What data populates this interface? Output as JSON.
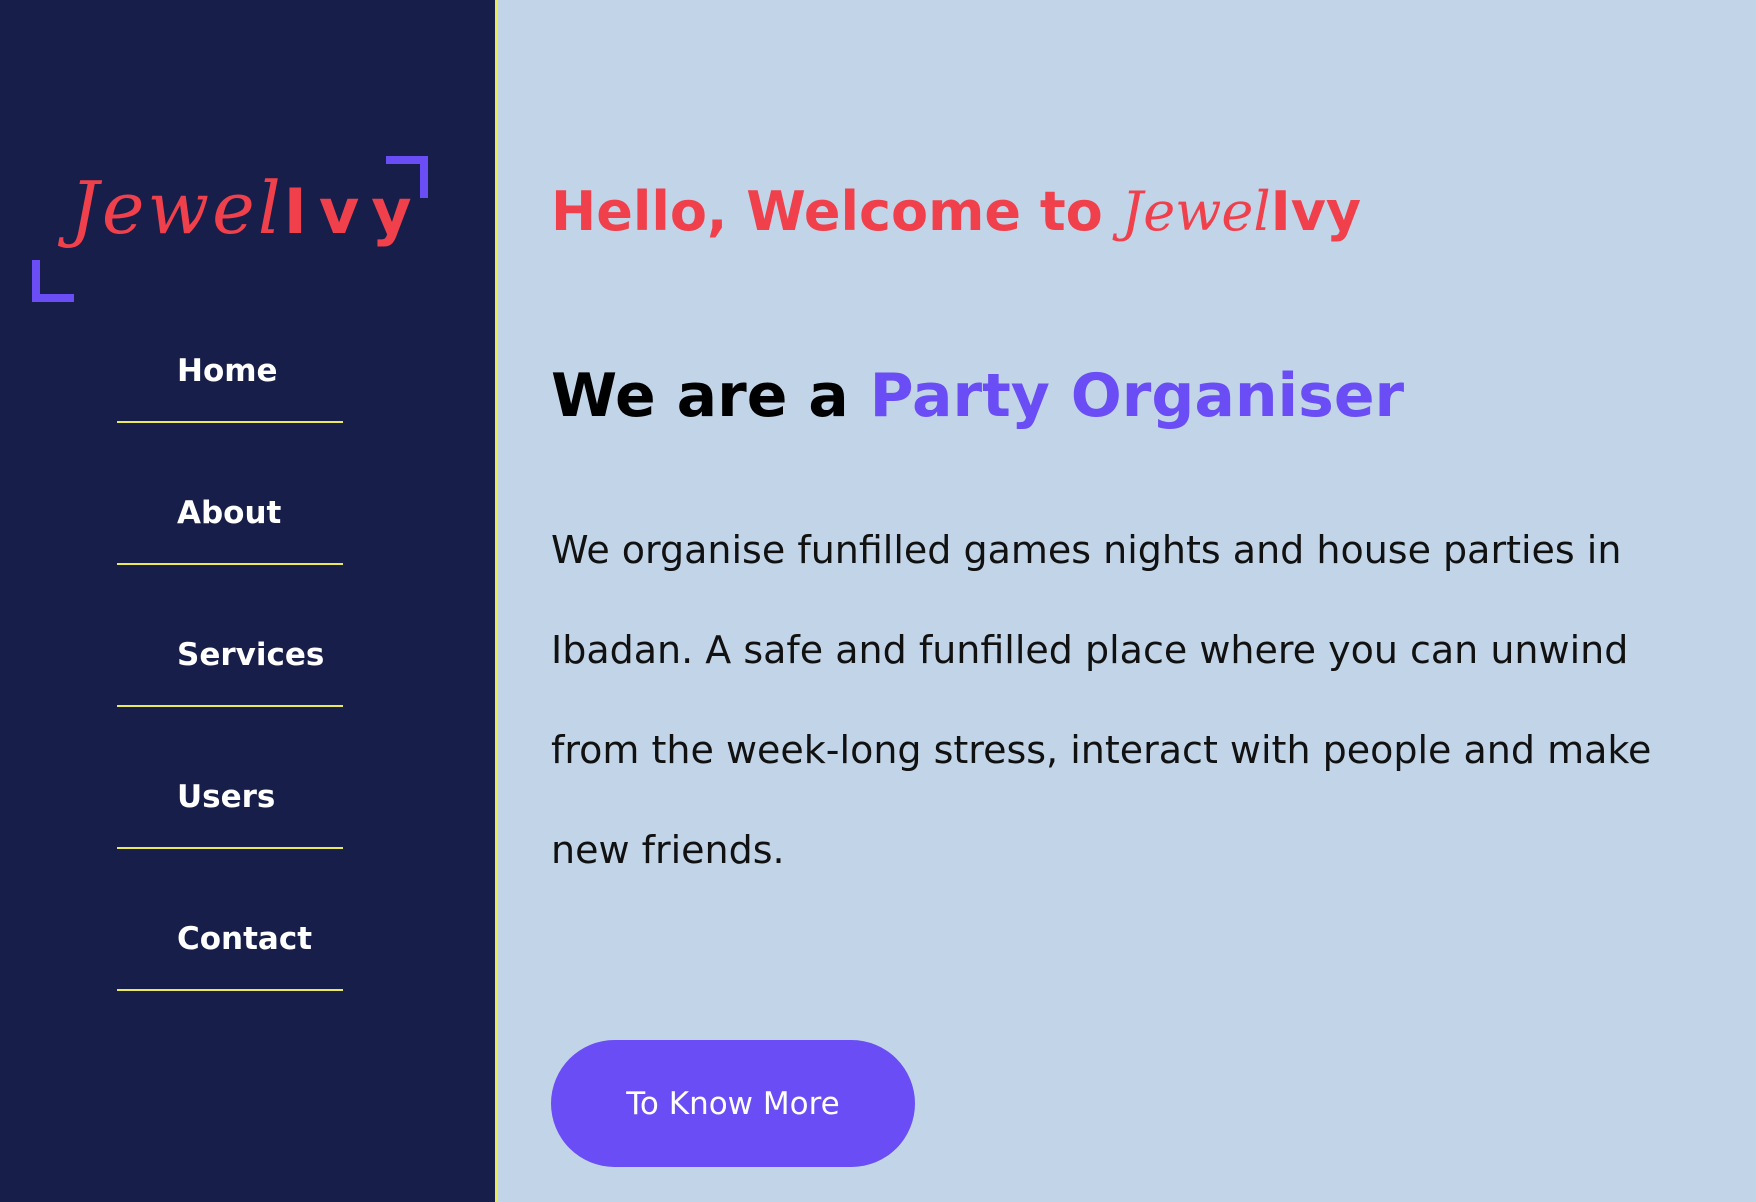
{
  "logo": {
    "script_part": "Jewel",
    "bold_part": "Ivy"
  },
  "nav": {
    "items": [
      {
        "label": "Home"
      },
      {
        "label": "About"
      },
      {
        "label": "Services"
      },
      {
        "label": "Users"
      },
      {
        "label": "Contact"
      }
    ]
  },
  "hero": {
    "greeting_prefix": "Hello, Welcome to ",
    "greeting_script": "Jewel",
    "greeting_bold": "Ivy",
    "headline_prefix": "We are a ",
    "headline_accent": "Party Organiser",
    "description": "We organise funfilled games nights and house parties in Ibadan. A safe and funfilled place where you can unwind from the week-long stress, interact with people and make new friends.",
    "cta_label": "To Know More"
  },
  "colors": {
    "sidebar_bg": "#161e49",
    "main_bg": "#c2d5e8",
    "brand_red": "#f0404c",
    "accent_purple": "#6a4df5",
    "divider_yellow": "#e8ea5a"
  },
  "icons": {
    "logo_corners": "bracket-corner-icon"
  }
}
